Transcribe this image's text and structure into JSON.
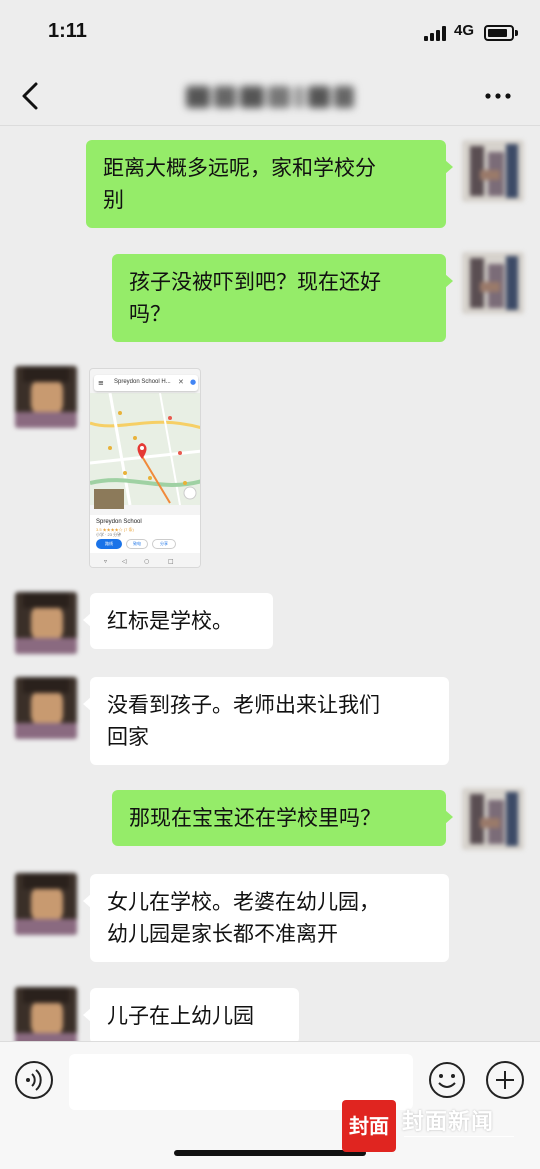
{
  "status_bar": {
    "time": "1:11",
    "network": "4G"
  },
  "nav": {
    "title": "",
    "back_icon": "back-chevron-icon",
    "more_icon": "more-dots-icon"
  },
  "messages": [
    {
      "side": "right",
      "type": "text",
      "text_lines": [
        "距离大概多远呢，家和学校分",
        "别"
      ]
    },
    {
      "side": "right",
      "type": "text",
      "text_lines": [
        "孩子没被吓到吧？现在还好",
        "吗？"
      ]
    },
    {
      "side": "left",
      "type": "image",
      "image": {
        "search_text": "Spreydon School H...",
        "place_name": "Spreydon School",
        "rating": "3.5 ★★★★☆ (7 条)",
        "place_type": "小学 · 23 分钟",
        "directions_label": "路线",
        "call_label": "致电",
        "share_label": "分享"
      }
    },
    {
      "side": "left",
      "type": "text",
      "text_lines": [
        "红标是学校。"
      ]
    },
    {
      "side": "left",
      "type": "text",
      "text_lines": [
        "没看到孩子。老师出来让我们",
        "回家"
      ]
    },
    {
      "side": "right",
      "type": "text",
      "text_lines": [
        "那现在宝宝还在学校里吗？"
      ]
    },
    {
      "side": "left",
      "type": "text",
      "text_lines": [
        "女儿在学校。老婆在幼儿园，",
        "幼儿园是家长都不准离开"
      ]
    },
    {
      "side": "left",
      "type": "text",
      "text_lines": [
        "儿子在上幼儿园"
      ]
    }
  ],
  "input_bar": {
    "placeholder": "",
    "voice_icon": "voice-icon",
    "emoji_icon": "emoji-icon",
    "plus_icon": "plus-icon"
  },
  "watermark": {
    "badge": "封面",
    "name": "封面新闻"
  },
  "colors": {
    "self_bubble": "#95ec69",
    "other_bubble": "#ffffff",
    "background": "#ededed",
    "brand_red": "#e02520"
  }
}
